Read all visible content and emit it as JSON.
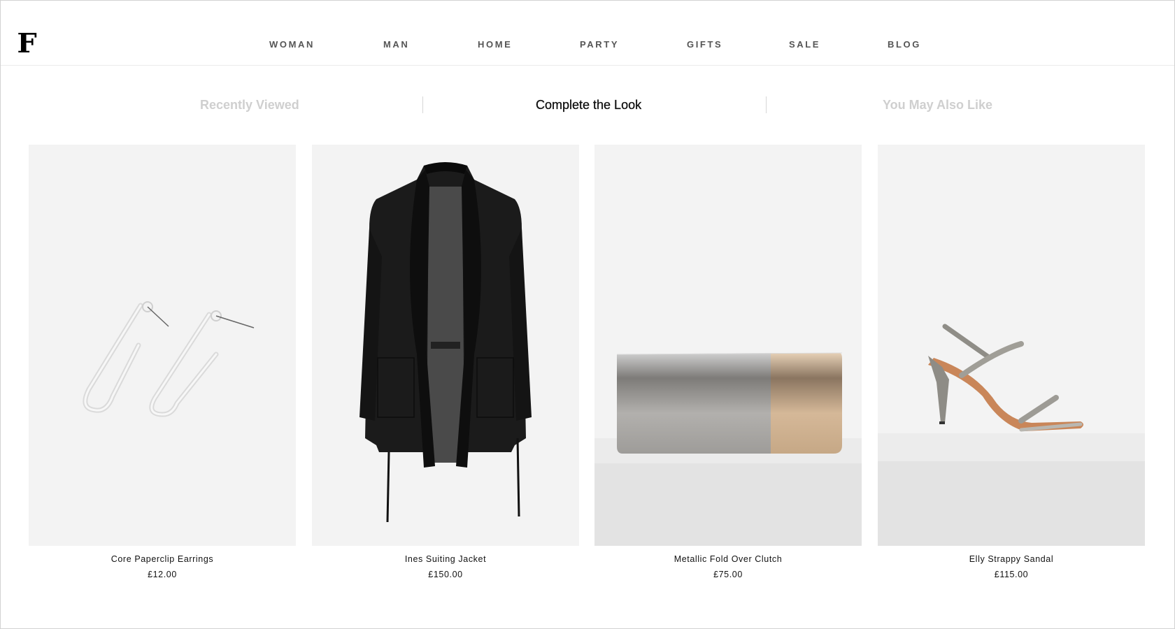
{
  "brand": {
    "logo_text": "F"
  },
  "nav": {
    "items": [
      {
        "label": "WOMAN"
      },
      {
        "label": "MAN"
      },
      {
        "label": "HOME"
      },
      {
        "label": "PARTY"
      },
      {
        "label": "GIFTS"
      },
      {
        "label": "SALE"
      },
      {
        "label": "BLOG"
      }
    ]
  },
  "tabs": {
    "items": [
      {
        "label": "Recently Viewed",
        "active": false
      },
      {
        "label": "Complete the Look",
        "active": true
      },
      {
        "label": "You May Also Like",
        "active": false
      }
    ]
  },
  "products": [
    {
      "name": "Core Paperclip Earrings",
      "price": "£12.00",
      "image": "silver-earrings"
    },
    {
      "name": "Ines Suiting Jacket",
      "price": "£150.00",
      "image": "black-jacket"
    },
    {
      "name": "Metallic Fold Over Clutch",
      "price": "£75.00",
      "image": "metallic-clutch"
    },
    {
      "name": "Elly Strappy Sandal",
      "price": "£115.00",
      "image": "metallic-sandal"
    }
  ],
  "colors": {
    "nav_text": "#555555",
    "tab_inactive": "#cfcfcf",
    "tab_active": "#111111",
    "image_bg": "#f3f3f3"
  }
}
